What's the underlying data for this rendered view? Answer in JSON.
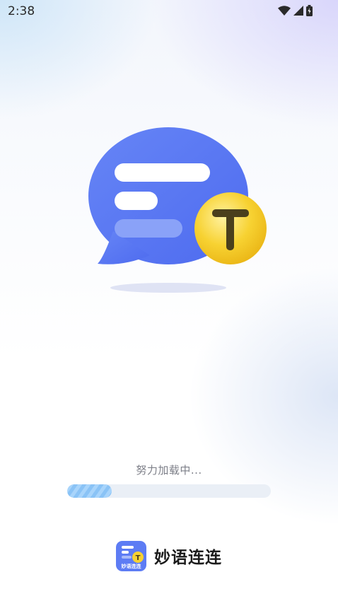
{
  "status_bar": {
    "time": "2:38",
    "icons": [
      "wifi-icon",
      "signal-icon",
      "battery-icon"
    ]
  },
  "hero": {
    "badge_letter": "T",
    "bubble_color": "#5b78f2",
    "badge_color": "#f7d232"
  },
  "loading": {
    "text": "努力加载中...",
    "progress": 0.22
  },
  "brand": {
    "icon_caption": "妙语连连",
    "icon_badge_letter": "T",
    "name": "妙语连连",
    "color": "#5d7cf4"
  }
}
